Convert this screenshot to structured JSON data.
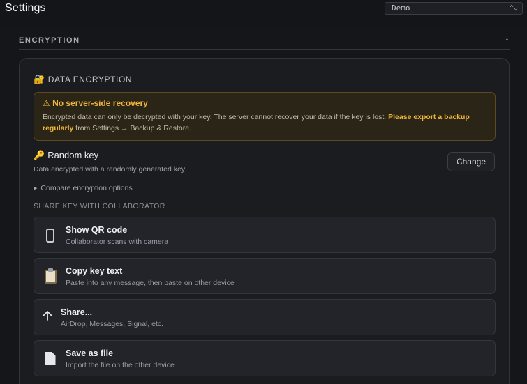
{
  "header": {
    "title": "Settings",
    "env_select": {
      "value": "Demo"
    }
  },
  "section": {
    "title": "ENCRYPTION",
    "collapse_marker": "•"
  },
  "card": {
    "title": "DATA ENCRYPTION",
    "title_icon": "🔐",
    "warning": {
      "title": "⚠ No server-side recovery",
      "body_prefix": "Encrypted data can only be decrypted with your key. The server cannot recover your data if the key is lost. ",
      "body_highlight": "Please export a backup regularly",
      "body_suffix": " from Settings → Backup & Restore."
    },
    "key": {
      "icon": "🔑",
      "title": "Random key",
      "subtitle": "Data encrypted with a randomly generated key.",
      "change_label": "Change"
    },
    "compare_label": "Compare encryption options",
    "share_label": "SHARE KEY WITH COLLABORATOR",
    "options": [
      {
        "icon": "phone-icon",
        "title": "Show QR code",
        "subtitle": "Collaborator scans with camera"
      },
      {
        "icon": "clipboard-icon",
        "title": "Copy key text",
        "subtitle": "Paste into any message, then paste on other device"
      },
      {
        "icon": "share-arrow-icon",
        "title": "Share...",
        "subtitle": "AirDrop, Messages, Signal, etc."
      },
      {
        "icon": "file-icon",
        "title": "Save as file",
        "subtitle": "Import the file on the other device"
      }
    ]
  },
  "colors": {
    "background": "#151619",
    "card": "#1b1c20",
    "warning_accent": "#f0b53a",
    "warning_bg": "#2b2518"
  }
}
